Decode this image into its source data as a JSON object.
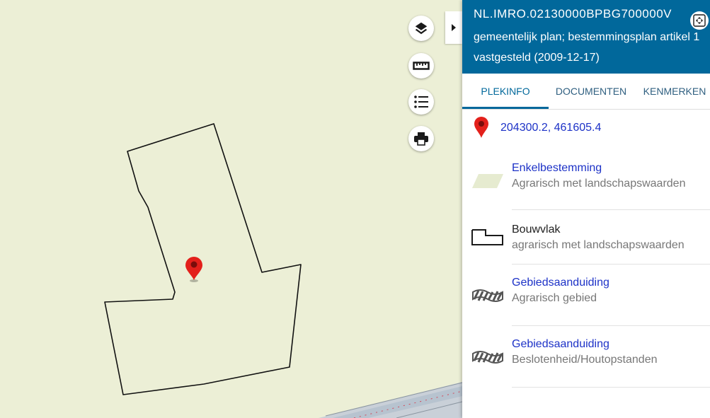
{
  "map": {
    "layers_icon": "layers-icon",
    "measure_icon": "ruler-icon",
    "legend_icon": "list-icon",
    "print_icon": "print-icon",
    "marker_color": "#e3201b",
    "background_color": "#ecefd6"
  },
  "panel": {
    "title": "NL.IMRO.02130000BPBG700000V",
    "subtitle": "gemeentelijk plan; bestemmingsplan artikel 1",
    "status": "vastgesteld (2009-12-17)",
    "header_color": "#01689b",
    "tabs": [
      {
        "label": "PLEKINFO",
        "active": true
      },
      {
        "label": "DOCUMENTEN",
        "active": false
      },
      {
        "label": "KENMERKEN",
        "active": false
      }
    ],
    "coordinates": "204300.2, 461605.4",
    "items": [
      {
        "label": "Enkelbestemming",
        "sublabel": "Agrarisch met landschapswaarden",
        "icon": "parallelogram-icon"
      },
      {
        "label": "Bouwvlak",
        "sublabel": "agrarisch met landschapswaarden",
        "icon": "building-outline-icon"
      },
      {
        "label": "Gebiedsaanduiding",
        "sublabel": "Agrarisch gebied",
        "icon": "hatched-band-icon"
      },
      {
        "label": "Gebiedsaanduiding",
        "sublabel": "Beslotenheid/Houtopstanden",
        "icon": "hatched-band-icon"
      }
    ]
  }
}
